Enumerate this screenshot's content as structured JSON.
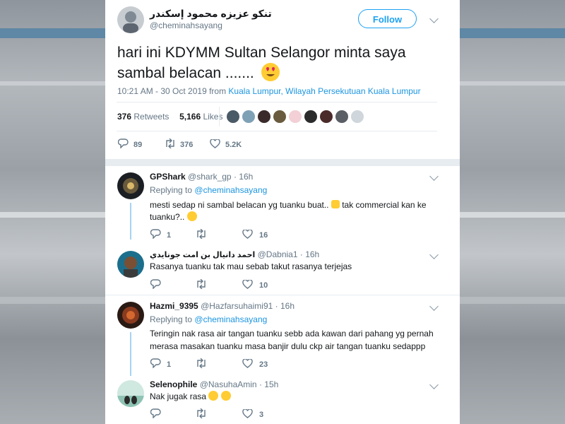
{
  "main_tweet": {
    "display_name": "تنکو عزيزه محمود إسکندر",
    "handle": "@cheminahsayang",
    "follow_label": "Follow",
    "text": "hari ini KDYMM Sultan Selangor minta saya sambal belacan .......",
    "emoji": "heart-eyes-emoji",
    "time": "10:21 AM - 30 Oct 2019 from",
    "location": "Kuala Lumpur, Wilayah Persekutuan Kuala Lumpur",
    "retweets_count": "376",
    "retweets_label": "Retweets",
    "likes_count": "5,166",
    "likes_label": "Likes",
    "actions": {
      "replies": "89",
      "retweets": "376",
      "likes": "5.2K"
    }
  },
  "replies": [
    {
      "name": "GPShark",
      "handle": "@shark_gp",
      "time": "· 16h",
      "replying_label": "Replying to",
      "replying_to": "@cheminahsayang",
      "text_line1": "mesti sedap ni sambal belacan yg tuanku buat..",
      "text_line1b": "tak commercial kan ke",
      "text_line2": "tuanku?..",
      "actions": {
        "replies": "1",
        "retweets": "",
        "likes": "16"
      }
    },
    {
      "name": "احمد دانيال بن امت جونايدي",
      "handle": "@Dabnia1",
      "time": "· 16h",
      "text_line1": "Rasanya tuanku tak mau sebab takut rasanya terjejas",
      "actions": {
        "replies": "",
        "retweets": "",
        "likes": "10"
      }
    },
    {
      "name": "Hazmi_9395",
      "handle": "@Hazfarsuhaimi91",
      "time": "· 16h",
      "replying_label": "Replying to",
      "replying_to": "@cheminahsayang",
      "text_line1": "Teringin nak rasa air tangan tuanku sebb ada kawan dari pahang yg pernah",
      "text_line2": "merasa masakan tuanku masa banjir dulu ckp air tangan tuanku sedappp",
      "actions": {
        "replies": "1",
        "retweets": "",
        "likes": "23"
      }
    },
    {
      "name": "Selenophile",
      "handle": "@NasuhaAmin",
      "time": "· 15h",
      "text_line1": "Nak jugak rasa",
      "actions": {
        "replies": "",
        "retweets": "",
        "likes": "3"
      }
    }
  ],
  "colors": {
    "accent": "#1da1f2",
    "link": "#1b95e0",
    "like_icon": "#657786"
  }
}
